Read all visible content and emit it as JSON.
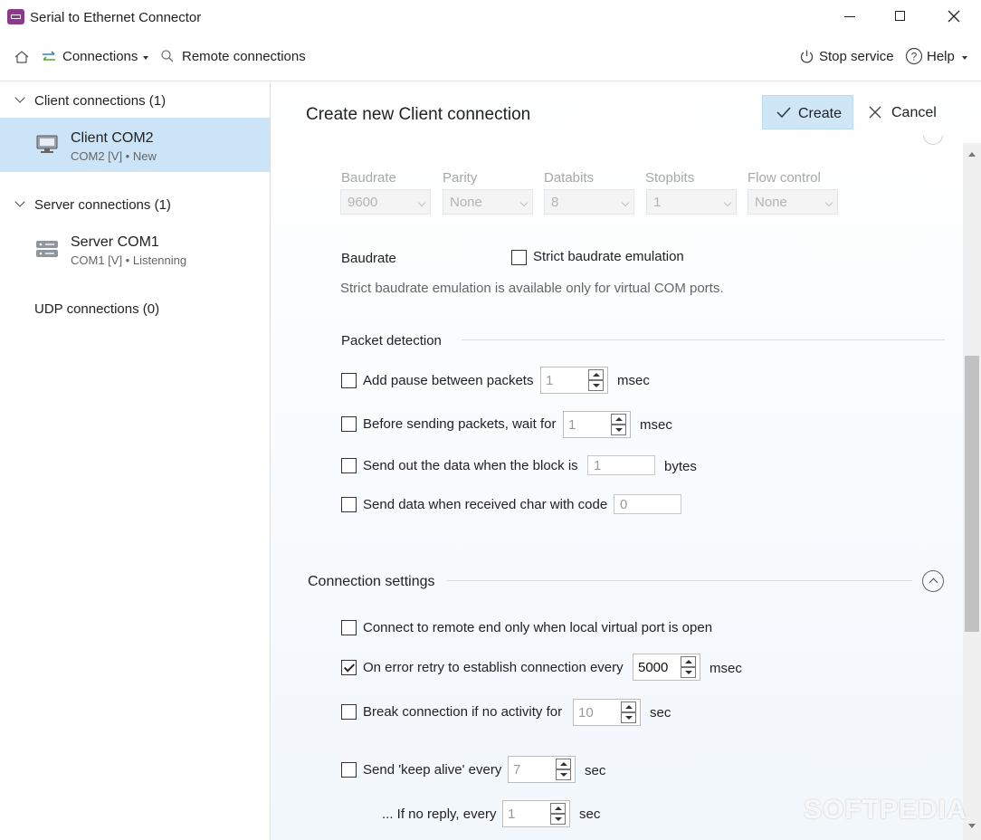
{
  "window": {
    "title": "Serial to Ethernet Connector"
  },
  "toolbar": {
    "connections_label": "Connections",
    "remote_label": "Remote connections",
    "stop_service_label": "Stop service",
    "help_label": "Help"
  },
  "sidebar": {
    "client_group": "Client connections (1)",
    "client_item_title": "Client COM2",
    "client_item_sub": "COM2 [V] • New",
    "server_group": "Server connections (1)",
    "server_item_title": "Server COM1",
    "server_item_sub": "COM1 [V] • Listenning",
    "udp_group": "UDP connections (0)"
  },
  "header": {
    "title": "Create new Client connection",
    "create_label": "Create",
    "cancel_label": "Cancel"
  },
  "port_settings": {
    "columns": [
      {
        "label": "Baudrate",
        "value": "9600"
      },
      {
        "label": "Parity",
        "value": "None"
      },
      {
        "label": "Databits",
        "value": "8"
      },
      {
        "label": "Stopbits",
        "value": "1"
      },
      {
        "label": "Flow control",
        "value": "None"
      }
    ],
    "baudrate_label": "Baudrate",
    "strict_label": "Strict baudrate emulation",
    "strict_checked": false,
    "strict_note": "Strict baudrate emulation is available only for virtual COM ports."
  },
  "packet_detection": {
    "title": "Packet detection",
    "pause_label": "Add pause between packets",
    "pause_value": "1",
    "pause_unit": "msec",
    "wait_label": "Before sending packets, wait for",
    "wait_value": "1",
    "wait_unit": "msec",
    "block_label": "Send out the data when the block is",
    "block_value": "1",
    "block_unit": "bytes",
    "char_label": "Send data when received char with code",
    "char_value": "0"
  },
  "connection_settings": {
    "title": "Connection settings",
    "remote_open_label": "Connect to remote end only when local virtual port is open",
    "retry_label": "On error retry to establish connection every",
    "retry_value": "5000",
    "retry_checked": true,
    "retry_unit": "msec",
    "break_label": "Break connection if no activity for",
    "break_value": "10",
    "break_unit": "sec",
    "keepalive_label": "Send 'keep alive' every",
    "keepalive_value": "7",
    "keepalive_unit": "sec",
    "noreply_label": "... If no reply, every",
    "noreply_value": "1",
    "noreply_unit": "sec"
  },
  "watermark": "SOFTPEDIA",
  "colors": {
    "selection": "#cce4f7",
    "accent_button": "#cfe6f7",
    "app_icon": "#8b3a8e"
  }
}
